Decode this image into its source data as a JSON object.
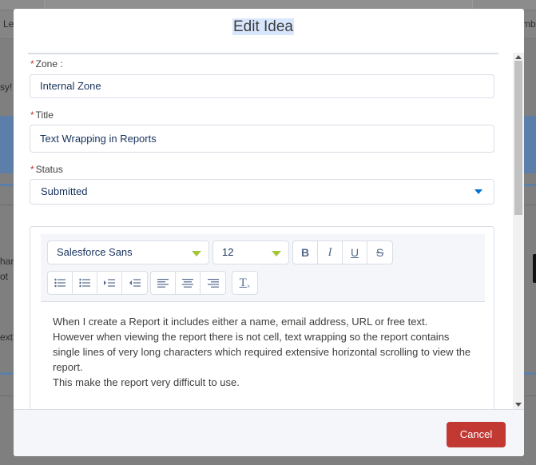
{
  "background": {
    "nav_left_text": "Le",
    "nav_right_text": "mbe",
    "fragment_easy": "sy!",
    "fragment_han": "han",
    "fragment_ot": "ot",
    "fragment_ext": "ext"
  },
  "modal": {
    "title": "Edit Idea",
    "fields": {
      "zone": {
        "required_marker": "*",
        "label": "Zone :",
        "value": "Internal Zone"
      },
      "title": {
        "required_marker": "*",
        "label": "Title",
        "value": "Text Wrapping in Reports"
      },
      "status": {
        "required_marker": "*",
        "label": "Status",
        "value": "Submitted"
      }
    },
    "editor": {
      "font_family": "Salesforce Sans",
      "font_size": "12",
      "buttons": {
        "bold": "B",
        "italic": "I",
        "underline": "U",
        "strikethrough": "S",
        "clear_format": "T"
      },
      "body": [
        "When I create a Report it includes either a name, email address, URL or free text.",
        "However when viewing the report there is not cell, text wrapping so the report contains single lines of very long characters which required extensive horizontal scrolling to view the report.",
        "This make the report very difficult to use."
      ]
    },
    "footer": {
      "cancel_label": "Cancel"
    },
    "colors": {
      "accent": "#0070d2",
      "danger": "#c23934",
      "dropdown_accent": "#a3c43b"
    }
  }
}
